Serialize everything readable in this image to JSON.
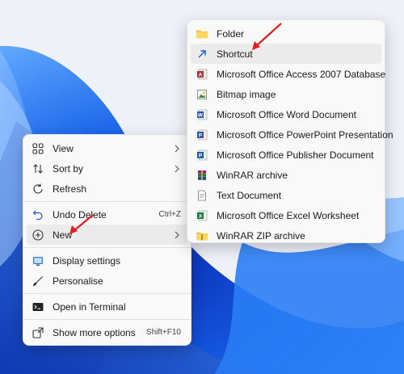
{
  "context_menu": {
    "items": [
      {
        "label": "View",
        "icon": "grid-view-icon",
        "has_submenu": true
      },
      {
        "label": "Sort by",
        "icon": "sort-icon",
        "has_submenu": true
      },
      {
        "label": "Refresh",
        "icon": "refresh-icon"
      },
      {
        "label": "Undo Delete",
        "icon": "undo-icon",
        "shortcut": "Ctrl+Z"
      },
      {
        "label": "New",
        "icon": "plus-circle-icon",
        "has_submenu": true,
        "highlighted": true
      },
      {
        "label": "Display settings",
        "icon": "display-icon"
      },
      {
        "label": "Personalise",
        "icon": "brush-icon"
      },
      {
        "label": "Open in Terminal",
        "icon": "terminal-icon"
      },
      {
        "label": "Show more options",
        "icon": "share-icon",
        "shortcut": "Shift+F10"
      }
    ]
  },
  "new_submenu": {
    "items": [
      {
        "label": "Folder",
        "icon": "folder-icon"
      },
      {
        "label": "Shortcut",
        "icon": "shortcut-arrow-icon",
        "highlighted": true
      },
      {
        "label": "Microsoft Office Access 2007 Database",
        "icon": "access-icon"
      },
      {
        "label": "Bitmap image",
        "icon": "bitmap-icon"
      },
      {
        "label": "Microsoft Office Word Document",
        "icon": "word-icon"
      },
      {
        "label": "Microsoft Office PowerPoint Presentation",
        "icon": "powerpoint-icon"
      },
      {
        "label": "Microsoft Office Publisher Document",
        "icon": "publisher-icon"
      },
      {
        "label": "WinRAR archive",
        "icon": "winrar-icon"
      },
      {
        "label": "Text Document",
        "icon": "text-document-icon"
      },
      {
        "label": "Microsoft Office Excel Worksheet",
        "icon": "excel-icon"
      },
      {
        "label": "WinRAR ZIP archive",
        "icon": "zip-folder-icon"
      }
    ]
  },
  "colors": {
    "wallpaper_blue": "#1565e0",
    "annotation_red": "#e02020",
    "highlight": "#ebebeb"
  }
}
